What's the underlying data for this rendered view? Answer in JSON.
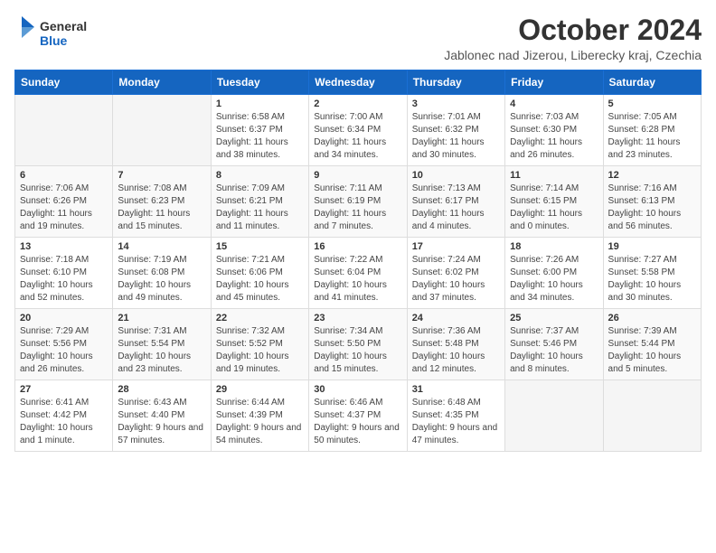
{
  "header": {
    "logo_general": "General",
    "logo_blue": "Blue",
    "month_title": "October 2024",
    "location": "Jablonec nad Jizerou, Liberecky kraj, Czechia"
  },
  "columns": [
    "Sunday",
    "Monday",
    "Tuesday",
    "Wednesday",
    "Thursday",
    "Friday",
    "Saturday"
  ],
  "weeks": [
    [
      {
        "day": "",
        "sunrise": "",
        "sunset": "",
        "daylight": ""
      },
      {
        "day": "",
        "sunrise": "",
        "sunset": "",
        "daylight": ""
      },
      {
        "day": "1",
        "sunrise": "Sunrise: 6:58 AM",
        "sunset": "Sunset: 6:37 PM",
        "daylight": "Daylight: 11 hours and 38 minutes."
      },
      {
        "day": "2",
        "sunrise": "Sunrise: 7:00 AM",
        "sunset": "Sunset: 6:34 PM",
        "daylight": "Daylight: 11 hours and 34 minutes."
      },
      {
        "day": "3",
        "sunrise": "Sunrise: 7:01 AM",
        "sunset": "Sunset: 6:32 PM",
        "daylight": "Daylight: 11 hours and 30 minutes."
      },
      {
        "day": "4",
        "sunrise": "Sunrise: 7:03 AM",
        "sunset": "Sunset: 6:30 PM",
        "daylight": "Daylight: 11 hours and 26 minutes."
      },
      {
        "day": "5",
        "sunrise": "Sunrise: 7:05 AM",
        "sunset": "Sunset: 6:28 PM",
        "daylight": "Daylight: 11 hours and 23 minutes."
      }
    ],
    [
      {
        "day": "6",
        "sunrise": "Sunrise: 7:06 AM",
        "sunset": "Sunset: 6:26 PM",
        "daylight": "Daylight: 11 hours and 19 minutes."
      },
      {
        "day": "7",
        "sunrise": "Sunrise: 7:08 AM",
        "sunset": "Sunset: 6:23 PM",
        "daylight": "Daylight: 11 hours and 15 minutes."
      },
      {
        "day": "8",
        "sunrise": "Sunrise: 7:09 AM",
        "sunset": "Sunset: 6:21 PM",
        "daylight": "Daylight: 11 hours and 11 minutes."
      },
      {
        "day": "9",
        "sunrise": "Sunrise: 7:11 AM",
        "sunset": "Sunset: 6:19 PM",
        "daylight": "Daylight: 11 hours and 7 minutes."
      },
      {
        "day": "10",
        "sunrise": "Sunrise: 7:13 AM",
        "sunset": "Sunset: 6:17 PM",
        "daylight": "Daylight: 11 hours and 4 minutes."
      },
      {
        "day": "11",
        "sunrise": "Sunrise: 7:14 AM",
        "sunset": "Sunset: 6:15 PM",
        "daylight": "Daylight: 11 hours and 0 minutes."
      },
      {
        "day": "12",
        "sunrise": "Sunrise: 7:16 AM",
        "sunset": "Sunset: 6:13 PM",
        "daylight": "Daylight: 10 hours and 56 minutes."
      }
    ],
    [
      {
        "day": "13",
        "sunrise": "Sunrise: 7:18 AM",
        "sunset": "Sunset: 6:10 PM",
        "daylight": "Daylight: 10 hours and 52 minutes."
      },
      {
        "day": "14",
        "sunrise": "Sunrise: 7:19 AM",
        "sunset": "Sunset: 6:08 PM",
        "daylight": "Daylight: 10 hours and 49 minutes."
      },
      {
        "day": "15",
        "sunrise": "Sunrise: 7:21 AM",
        "sunset": "Sunset: 6:06 PM",
        "daylight": "Daylight: 10 hours and 45 minutes."
      },
      {
        "day": "16",
        "sunrise": "Sunrise: 7:22 AM",
        "sunset": "Sunset: 6:04 PM",
        "daylight": "Daylight: 10 hours and 41 minutes."
      },
      {
        "day": "17",
        "sunrise": "Sunrise: 7:24 AM",
        "sunset": "Sunset: 6:02 PM",
        "daylight": "Daylight: 10 hours and 37 minutes."
      },
      {
        "day": "18",
        "sunrise": "Sunrise: 7:26 AM",
        "sunset": "Sunset: 6:00 PM",
        "daylight": "Daylight: 10 hours and 34 minutes."
      },
      {
        "day": "19",
        "sunrise": "Sunrise: 7:27 AM",
        "sunset": "Sunset: 5:58 PM",
        "daylight": "Daylight: 10 hours and 30 minutes."
      }
    ],
    [
      {
        "day": "20",
        "sunrise": "Sunrise: 7:29 AM",
        "sunset": "Sunset: 5:56 PM",
        "daylight": "Daylight: 10 hours and 26 minutes."
      },
      {
        "day": "21",
        "sunrise": "Sunrise: 7:31 AM",
        "sunset": "Sunset: 5:54 PM",
        "daylight": "Daylight: 10 hours and 23 minutes."
      },
      {
        "day": "22",
        "sunrise": "Sunrise: 7:32 AM",
        "sunset": "Sunset: 5:52 PM",
        "daylight": "Daylight: 10 hours and 19 minutes."
      },
      {
        "day": "23",
        "sunrise": "Sunrise: 7:34 AM",
        "sunset": "Sunset: 5:50 PM",
        "daylight": "Daylight: 10 hours and 15 minutes."
      },
      {
        "day": "24",
        "sunrise": "Sunrise: 7:36 AM",
        "sunset": "Sunset: 5:48 PM",
        "daylight": "Daylight: 10 hours and 12 minutes."
      },
      {
        "day": "25",
        "sunrise": "Sunrise: 7:37 AM",
        "sunset": "Sunset: 5:46 PM",
        "daylight": "Daylight: 10 hours and 8 minutes."
      },
      {
        "day": "26",
        "sunrise": "Sunrise: 7:39 AM",
        "sunset": "Sunset: 5:44 PM",
        "daylight": "Daylight: 10 hours and 5 minutes."
      }
    ],
    [
      {
        "day": "27",
        "sunrise": "Sunrise: 6:41 AM",
        "sunset": "Sunset: 4:42 PM",
        "daylight": "Daylight: 10 hours and 1 minute."
      },
      {
        "day": "28",
        "sunrise": "Sunrise: 6:43 AM",
        "sunset": "Sunset: 4:40 PM",
        "daylight": "Daylight: 9 hours and 57 minutes."
      },
      {
        "day": "29",
        "sunrise": "Sunrise: 6:44 AM",
        "sunset": "Sunset: 4:39 PM",
        "daylight": "Daylight: 9 hours and 54 minutes."
      },
      {
        "day": "30",
        "sunrise": "Sunrise: 6:46 AM",
        "sunset": "Sunset: 4:37 PM",
        "daylight": "Daylight: 9 hours and 50 minutes."
      },
      {
        "day": "31",
        "sunrise": "Sunrise: 6:48 AM",
        "sunset": "Sunset: 4:35 PM",
        "daylight": "Daylight: 9 hours and 47 minutes."
      },
      {
        "day": "",
        "sunrise": "",
        "sunset": "",
        "daylight": ""
      },
      {
        "day": "",
        "sunrise": "",
        "sunset": "",
        "daylight": ""
      }
    ]
  ]
}
